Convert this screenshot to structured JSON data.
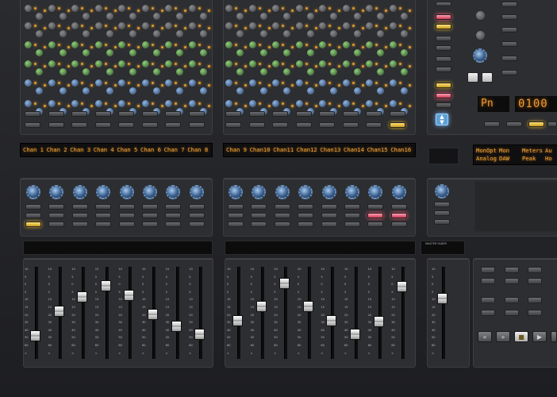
{
  "display_left": [
    "Chan 1",
    "Chan 2",
    "Chan 3",
    "Chan 4",
    "Chan 5",
    "Chan 6",
    "Chan 7",
    "Chan 8"
  ],
  "display_right": [
    "Chan 9",
    "Chan10",
    "Chan11",
    "Chan12",
    "Chan13",
    "Chan14",
    "Chan15",
    "Chan16"
  ],
  "status_display": {
    "cols": [
      {
        "top": "MonOpt",
        "bottom": "Analog"
      },
      {
        "top": "Mon",
        "bottom": "DAW"
      },
      {
        "top": "Meters",
        "bottom": "Peak"
      },
      {
        "top": "Au",
        "bottom": "Ho"
      }
    ]
  },
  "mode_display": "Pn",
  "counter_display": "0100",
  "master_label": "MASTER FADER",
  "fader_scale": [
    "10",
    "5",
    "0",
    "5",
    "10",
    "15",
    "20",
    "30",
    "40",
    "50",
    "60",
    "∞"
  ],
  "colors": {
    "amber": "#f0a63a",
    "blue_knob": "#4f7fb8",
    "pink": "#ff5b7a",
    "yellow": "#e3b32a"
  }
}
